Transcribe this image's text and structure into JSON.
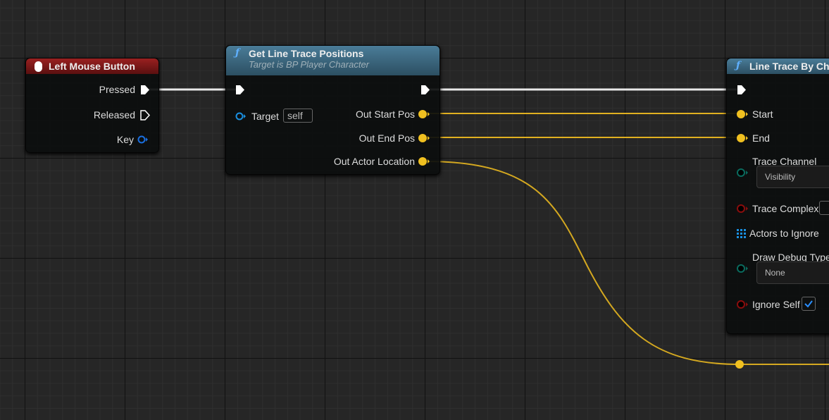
{
  "nodes": {
    "lmb": {
      "title": "Left Mouse Button",
      "pins": [
        "Pressed",
        "Released",
        "Key"
      ],
      "color": "#8b1a1a"
    },
    "glt": {
      "title": "Get Line Trace Positions",
      "subtitle": "Target is BP Player Character",
      "target_label": "Target",
      "target_value": "self",
      "outputs": [
        "Out Start Pos",
        "Out End Pos",
        "Out Actor Location"
      ],
      "color": "#3d6a85"
    },
    "ltc": {
      "title": "Line Trace By Cha",
      "start": "Start",
      "end": "End",
      "trace_channel": "Trace Channel",
      "trace_channel_value": "Visibility",
      "trace_complex": "Trace Complex",
      "actors_to_ignore": "Actors to Ignore",
      "draw_debug_type": "Draw Debug Type",
      "draw_debug_value": "None",
      "ignore_self": "Ignore Self",
      "ignore_self_checked": true
    }
  },
  "colors": {
    "exec": "#ffffff",
    "vector": "#f0c020",
    "object": "#1a8fe0",
    "bool": "#8b0d0d",
    "enum": "#0a6b5e"
  }
}
